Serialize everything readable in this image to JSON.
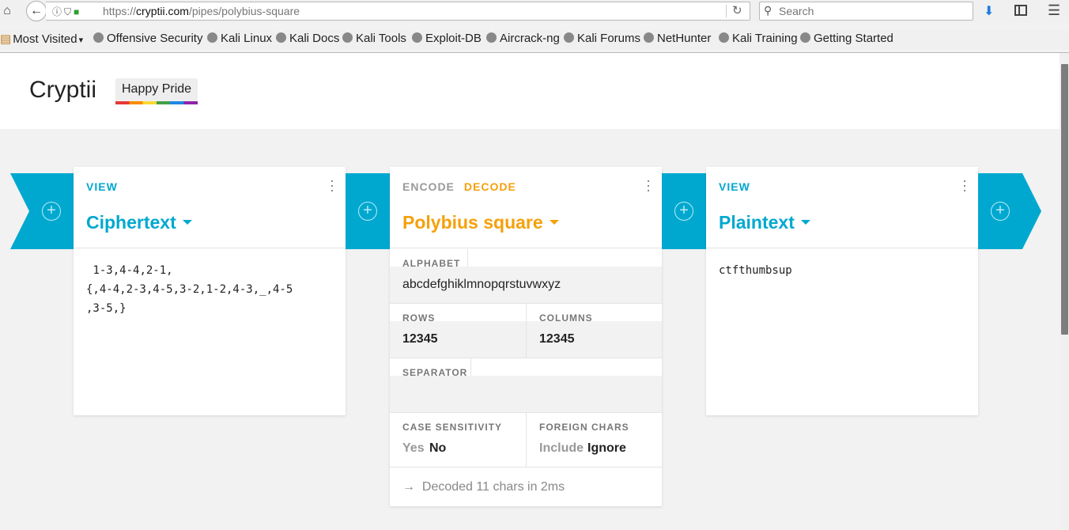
{
  "browser": {
    "url_prefix": "https://",
    "url_domain": "cryptii.com",
    "url_path": "/pipes/polybius-square",
    "search_placeholder": "Search"
  },
  "bookmarks": [
    {
      "label": "Most Visited",
      "icon": "folder-icon"
    },
    {
      "label": "Offensive Security",
      "icon": "globe-icon"
    },
    {
      "label": "Kali Linux",
      "icon": "globe-icon"
    },
    {
      "label": "Kali Docs",
      "icon": "globe-icon"
    },
    {
      "label": "Kali Tools",
      "icon": "globe-icon"
    },
    {
      "label": "Exploit-DB",
      "icon": "globe-icon"
    },
    {
      "label": "Aircrack-ng",
      "icon": "globe-icon"
    },
    {
      "label": "Kali Forums",
      "icon": "globe-icon"
    },
    {
      "label": "NetHunter",
      "icon": "globe-icon"
    },
    {
      "label": "Kali Training",
      "icon": "globe-icon"
    },
    {
      "label": "Getting Started",
      "icon": "globe-icon"
    }
  ],
  "app": {
    "logo": "Cryptii",
    "badge": "Happy Pride"
  },
  "colors": {
    "accent_view": "#00a8cf",
    "accent_encoder": "#f5a00c"
  },
  "bricks": {
    "ciphertext": {
      "mode": "VIEW",
      "title": "Ciphertext",
      "content": " 1-3,4-4,2-1,\n{,4-4,2-3,4-5,3-2,1-2,4-3,_,4-5\n,3-5,}"
    },
    "polybius": {
      "mode_encode": "ENCODE",
      "mode_decode": "DECODE",
      "title": "Polybius square",
      "alphabet_label": "ALPHABET",
      "alphabet_value": "abcdefghiklmnopqrstuvwxyz",
      "rows_label": "ROWS",
      "rows_value": "12345",
      "columns_label": "COLUMNS",
      "columns_value": "12345",
      "separator_label": "SEPARATOR",
      "separator_value": "",
      "case_label": "CASE SENSITIVITY",
      "case_yes": "Yes",
      "case_no": "No",
      "foreign_label": "FOREIGN CHARS",
      "foreign_include": "Include",
      "foreign_ignore": "Ignore",
      "status": "Decoded 11 chars in 2ms"
    },
    "plaintext": {
      "mode": "VIEW",
      "title": "Plaintext",
      "content": "ctfthumbsup"
    }
  }
}
